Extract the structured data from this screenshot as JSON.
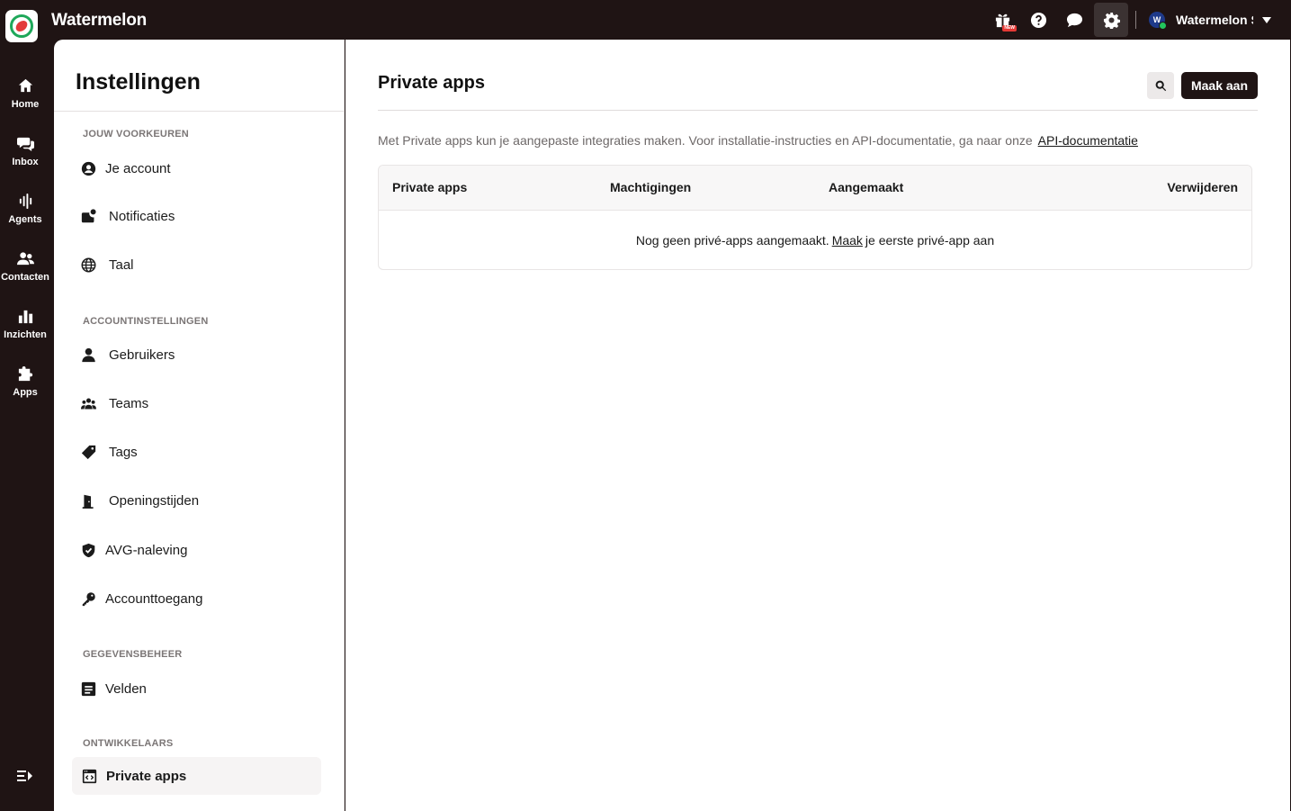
{
  "app": {
    "name": "Watermelon"
  },
  "topbar": {
    "gift_badge": "NEW",
    "account_initial": "W",
    "account_name": "Watermelon S"
  },
  "rail": {
    "items": [
      {
        "label": "Home",
        "icon": "home-icon"
      },
      {
        "label": "Inbox",
        "icon": "chat-bubbles-icon"
      },
      {
        "label": "Agents",
        "icon": "agents-bars-icon"
      },
      {
        "label": "Contacten",
        "icon": "contacts-icon"
      },
      {
        "label": "Inzichten",
        "icon": "bar-chart-icon"
      },
      {
        "label": "Apps",
        "icon": "puzzle-icon"
      }
    ]
  },
  "settings": {
    "title": "Instellingen",
    "sections": [
      {
        "heading": "JOUW VOORKEUREN",
        "items": [
          "Je account",
          "Notificaties",
          "Taal"
        ]
      },
      {
        "heading": "ACCOUNTINSTELLINGEN",
        "items": [
          "Gebruikers",
          "Teams",
          "Tags",
          "Openingstijden",
          "AVG-naleving",
          "Accounttoegang"
        ]
      },
      {
        "heading": "GEGEVENSBEHEER",
        "items": [
          "Velden"
        ]
      },
      {
        "heading": "ONTWIKKELAARS",
        "items": [
          "Private apps"
        ]
      }
    ],
    "selected": "Private apps"
  },
  "main": {
    "title": "Private apps",
    "create_button": "Maak aan",
    "description": "Met Private apps kun je aangepaste integraties maken. Voor installatie-instructies en API-documentatie, ga naar onze",
    "description_link": "API-documentatie",
    "table": {
      "columns": [
        "Private apps",
        "Machtigingen",
        "Aangemaakt",
        "Verwijderen"
      ],
      "empty_before": "Nog geen privé-apps aangemaakt.",
      "empty_link": "Maak",
      "empty_after": "je eerste privé-app aan"
    }
  }
}
